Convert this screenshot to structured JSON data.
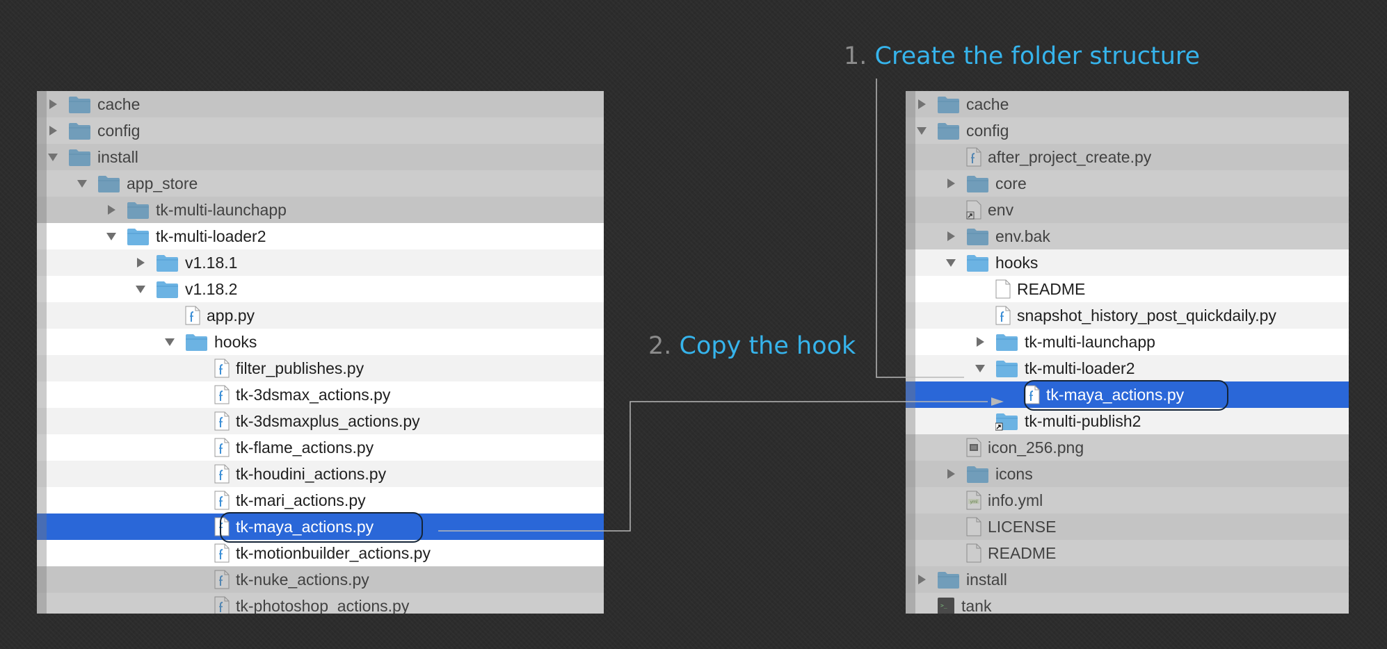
{
  "steps": {
    "step1": {
      "number": "1.",
      "text": "Create the folder structure"
    },
    "step2": {
      "number": "2.",
      "text": "Copy the hook"
    }
  },
  "colors": {
    "background": "#2c2c2c",
    "folder_blue": "#6cb3e3",
    "selection_blue": "#2a67d8",
    "annotation_text": "#36b4ec",
    "annotation_number": "#8c8c8c"
  },
  "left_tree": {
    "rows": [
      {
        "label": "cache",
        "icon": "folder-icon",
        "disclosure": "collapsed"
      },
      {
        "label": "config",
        "icon": "folder-icon",
        "disclosure": "collapsed"
      },
      {
        "label": "install",
        "icon": "folder-icon",
        "disclosure": "expanded"
      },
      {
        "label": "app_store",
        "icon": "folder-icon",
        "disclosure": "expanded"
      },
      {
        "label": "tk-multi-launchapp",
        "icon": "folder-icon",
        "disclosure": "collapsed"
      },
      {
        "label": "tk-multi-loader2",
        "icon": "folder-icon",
        "disclosure": "expanded"
      },
      {
        "label": "v1.18.1",
        "icon": "folder-icon",
        "disclosure": "collapsed"
      },
      {
        "label": "v1.18.2",
        "icon": "folder-icon",
        "disclosure": "expanded"
      },
      {
        "label": "app.py",
        "icon": "python-file-icon",
        "disclosure": "none"
      },
      {
        "label": "hooks",
        "icon": "folder-icon",
        "disclosure": "expanded"
      },
      {
        "label": "filter_publishes.py",
        "icon": "python-file-icon",
        "disclosure": "none"
      },
      {
        "label": "tk-3dsmax_actions.py",
        "icon": "python-file-icon",
        "disclosure": "none"
      },
      {
        "label": "tk-3dsmaxplus_actions.py",
        "icon": "python-file-icon",
        "disclosure": "none"
      },
      {
        "label": "tk-flame_actions.py",
        "icon": "python-file-icon",
        "disclosure": "none"
      },
      {
        "label": "tk-houdini_actions.py",
        "icon": "python-file-icon",
        "disclosure": "none"
      },
      {
        "label": "tk-mari_actions.py",
        "icon": "python-file-icon",
        "disclosure": "none"
      },
      {
        "label": "tk-maya_actions.py",
        "icon": "python-file-icon",
        "disclosure": "none",
        "selected": true
      },
      {
        "label": "tk-motionbuilder_actions.py",
        "icon": "python-file-icon",
        "disclosure": "none"
      },
      {
        "label": "tk-nuke_actions.py",
        "icon": "python-file-icon",
        "disclosure": "none"
      },
      {
        "label": "tk-photoshop_actions.py",
        "icon": "python-file-icon",
        "disclosure": "none"
      }
    ]
  },
  "right_tree": {
    "rows": [
      {
        "label": "cache",
        "icon": "folder-icon",
        "disclosure": "collapsed"
      },
      {
        "label": "config",
        "icon": "folder-icon",
        "disclosure": "expanded"
      },
      {
        "label": "after_project_create.py",
        "icon": "python-file-icon",
        "disclosure": "none"
      },
      {
        "label": "core",
        "icon": "folder-icon",
        "disclosure": "collapsed"
      },
      {
        "label": "env",
        "icon": "alias-icon",
        "disclosure": "none"
      },
      {
        "label": "env.bak",
        "icon": "folder-icon",
        "disclosure": "collapsed"
      },
      {
        "label": "hooks",
        "icon": "folder-icon",
        "disclosure": "expanded"
      },
      {
        "label": "README",
        "icon": "document-icon",
        "disclosure": "none"
      },
      {
        "label": "snapshot_history_post_quickdaily.py",
        "icon": "python-file-icon",
        "disclosure": "none"
      },
      {
        "label": "tk-multi-launchapp",
        "icon": "folder-icon",
        "disclosure": "collapsed"
      },
      {
        "label": "tk-multi-loader2",
        "icon": "folder-icon",
        "disclosure": "expanded"
      },
      {
        "label": "tk-maya_actions.py",
        "icon": "python-file-icon",
        "disclosure": "none",
        "selected": true
      },
      {
        "label": "tk-multi-publish2",
        "icon": "folder-alias-icon",
        "disclosure": "none"
      },
      {
        "label": "icon_256.png",
        "icon": "image-file-icon",
        "disclosure": "none"
      },
      {
        "label": "icons",
        "icon": "folder-icon",
        "disclosure": "collapsed"
      },
      {
        "label": "info.yml",
        "icon": "yml-file-icon",
        "disclosure": "none"
      },
      {
        "label": "LICENSE",
        "icon": "document-icon",
        "disclosure": "none"
      },
      {
        "label": "README",
        "icon": "document-icon",
        "disclosure": "none"
      },
      {
        "label": "install",
        "icon": "folder-icon",
        "disclosure": "collapsed"
      },
      {
        "label": "tank",
        "icon": "executable-icon",
        "disclosure": "none"
      }
    ]
  }
}
